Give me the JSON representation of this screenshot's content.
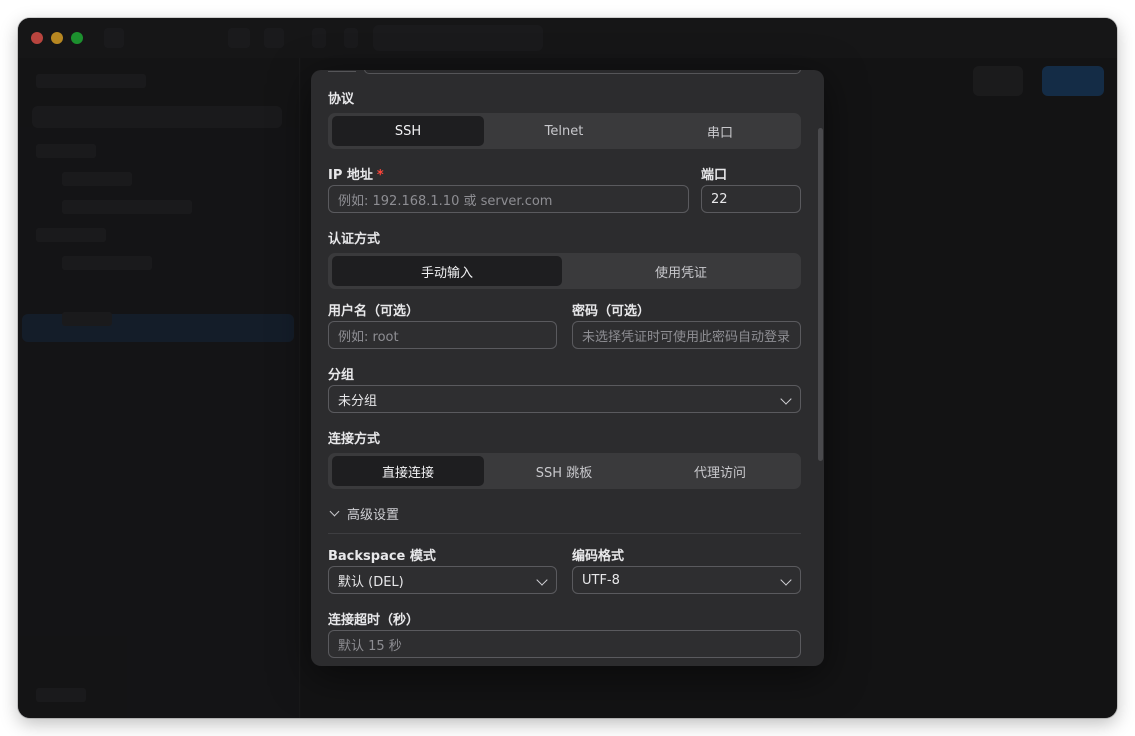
{
  "form": {
    "protocol": {
      "label": "协议",
      "options": [
        "SSH",
        "Telnet",
        "串口"
      ],
      "selected": "SSH"
    },
    "ip": {
      "label": "IP 地址",
      "required_mark": "*",
      "placeholder": "例如: 192.168.1.10 或 server.com"
    },
    "port": {
      "label": "端口",
      "value": "22"
    },
    "auth": {
      "label": "认证方式",
      "options": [
        "手动输入",
        "使用凭证"
      ],
      "selected": "手动输入"
    },
    "username": {
      "label": "用户名（可选）",
      "placeholder": "例如: root"
    },
    "password": {
      "label": "密码（可选）",
      "placeholder": "未选择凭证时可使用此密码自动登录"
    },
    "group": {
      "label": "分组",
      "value": "未分组"
    },
    "connection": {
      "label": "连接方式",
      "options": [
        "直接连接",
        "SSH 跳板",
        "代理访问"
      ],
      "selected": "直接连接"
    },
    "advanced": {
      "label": "高级设置",
      "expanded": true
    },
    "backspace": {
      "label": "Backspace 模式",
      "value": "默认 (DEL)"
    },
    "encoding": {
      "label": "编码格式",
      "value": "UTF-8"
    },
    "timeout": {
      "label": "连接超时（秒）",
      "placeholder": "默认 15 秒"
    }
  },
  "colors": {
    "window_bg": "#1c1c1e",
    "modal_bg": "#2c2c2e",
    "segment_bg": "#3a3a3c",
    "segment_active": "#1e1e20",
    "required": "#ff453a",
    "accent": "#0a84ff"
  }
}
